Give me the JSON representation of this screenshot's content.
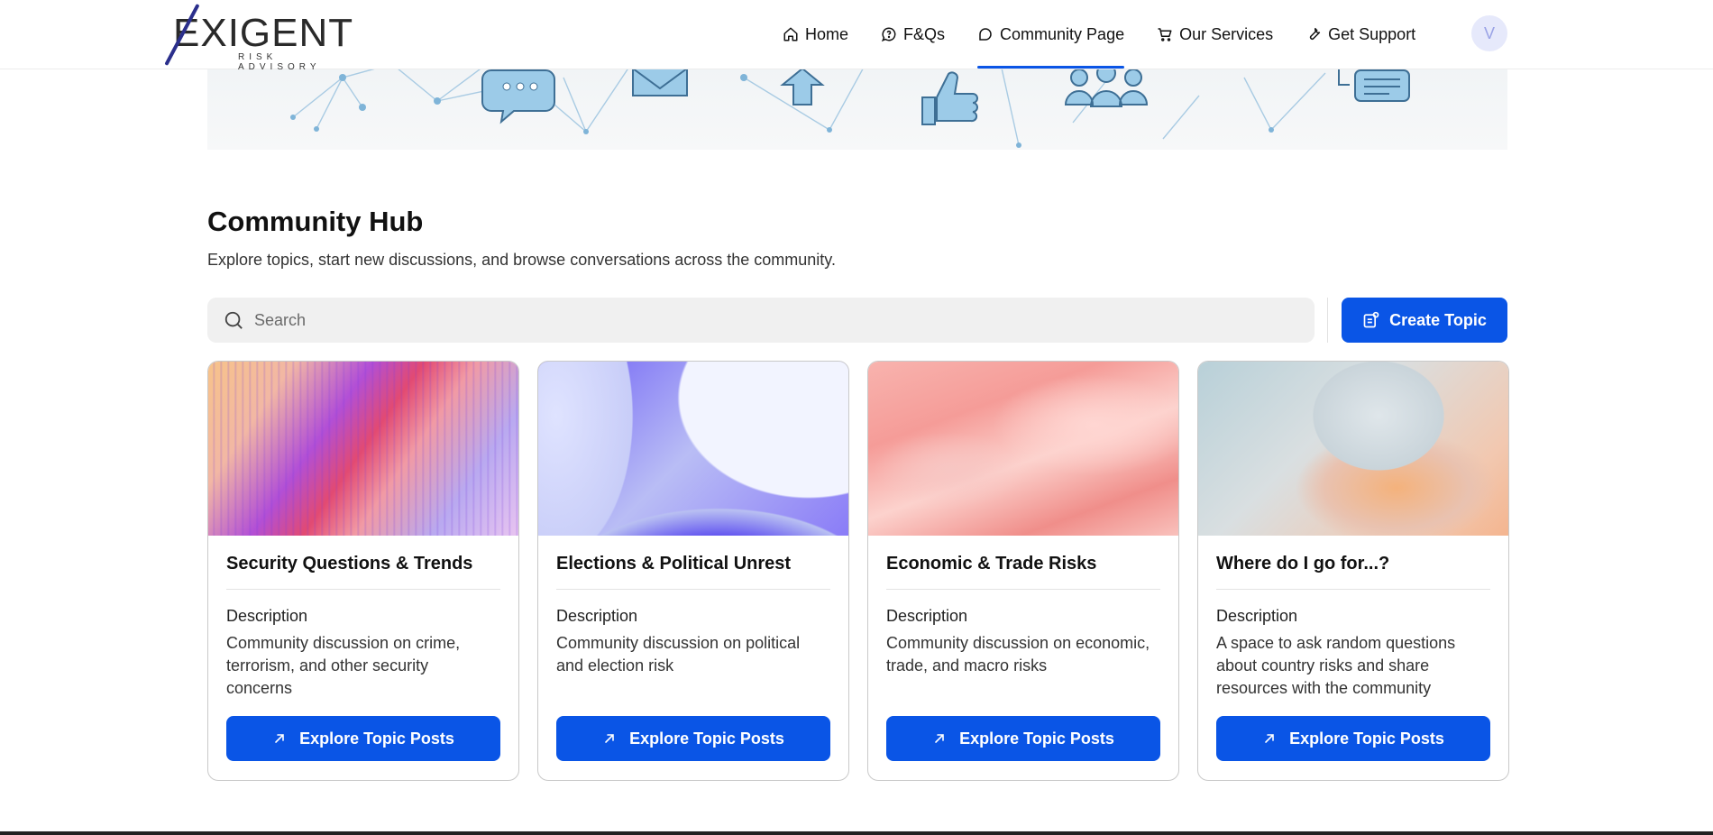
{
  "header": {
    "logo_main": "EXIGENT",
    "logo_sub": "RISK ADVISORY",
    "nav": [
      {
        "label": "Home",
        "icon": "home-icon",
        "active": false
      },
      {
        "label": "F&Qs",
        "icon": "chat-question-icon",
        "active": false
      },
      {
        "label": "Community Page",
        "icon": "chat-bubble-icon",
        "active": true
      },
      {
        "label": "Our Services",
        "icon": "cart-icon",
        "active": false
      },
      {
        "label": "Get Support",
        "icon": "wrench-icon",
        "active": false
      }
    ],
    "avatar_initial": "V"
  },
  "hub": {
    "title": "Community Hub",
    "subtitle": "Explore topics, start new discussions, and browse conversations across the community.",
    "search_placeholder": "Search",
    "create_label": "Create Topic"
  },
  "cards": [
    {
      "title": "Security Questions & Trends",
      "desc_label": "Description",
      "desc": "Community discussion on crime, terrorism, and other security concerns",
      "button": "Explore Topic Posts"
    },
    {
      "title": "Elections & Political Unrest",
      "desc_label": "Description",
      "desc": "Community discussion on political and election risk",
      "button": "Explore Topic Posts"
    },
    {
      "title": "Economic & Trade Risks",
      "desc_label": "Description",
      "desc": "Community discussion on economic, trade, and macro risks",
      "button": "Explore Topic Posts"
    },
    {
      "title": "Where do I go for...?",
      "desc_label": "Description",
      "desc": "A space to ask random questions about country risks and share resources with the community",
      "button": "Explore Topic Posts"
    }
  ],
  "colors": {
    "accent": "#0a55e6",
    "banner_icon": "#7fb4d8"
  }
}
